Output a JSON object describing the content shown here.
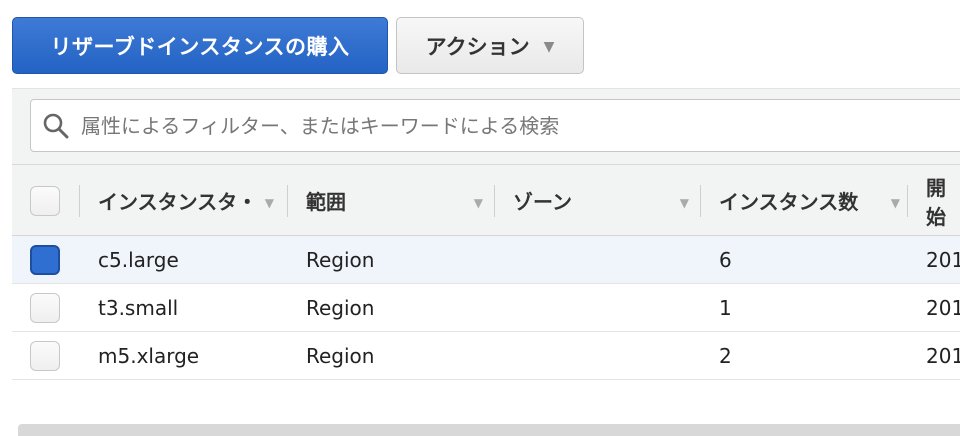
{
  "toolbar": {
    "buy_button": "リザーブドインスタンスの購入",
    "actions_button": "アクション"
  },
  "search": {
    "placeholder": "属性によるフィルター、またはキーワードによる検索"
  },
  "table": {
    "columns": [
      "インスタンスタ・",
      "範囲",
      "ゾーン",
      "インスタンス数",
      "開始"
    ],
    "rows": [
      {
        "type": "c5.large",
        "scope": "Region",
        "zone": "",
        "count": "6",
        "start": "201",
        "checked": true
      },
      {
        "type": "t3.small",
        "scope": "Region",
        "zone": "",
        "count": "1",
        "start": "201",
        "checked": false
      },
      {
        "type": "m5.xlarge",
        "scope": "Region",
        "zone": "",
        "count": "2",
        "start": "201",
        "checked": false
      }
    ]
  },
  "colors": {
    "primary": "#2e6fd1",
    "selected_row": "#f0f4fb",
    "header_bg": "#f2f3f3"
  }
}
